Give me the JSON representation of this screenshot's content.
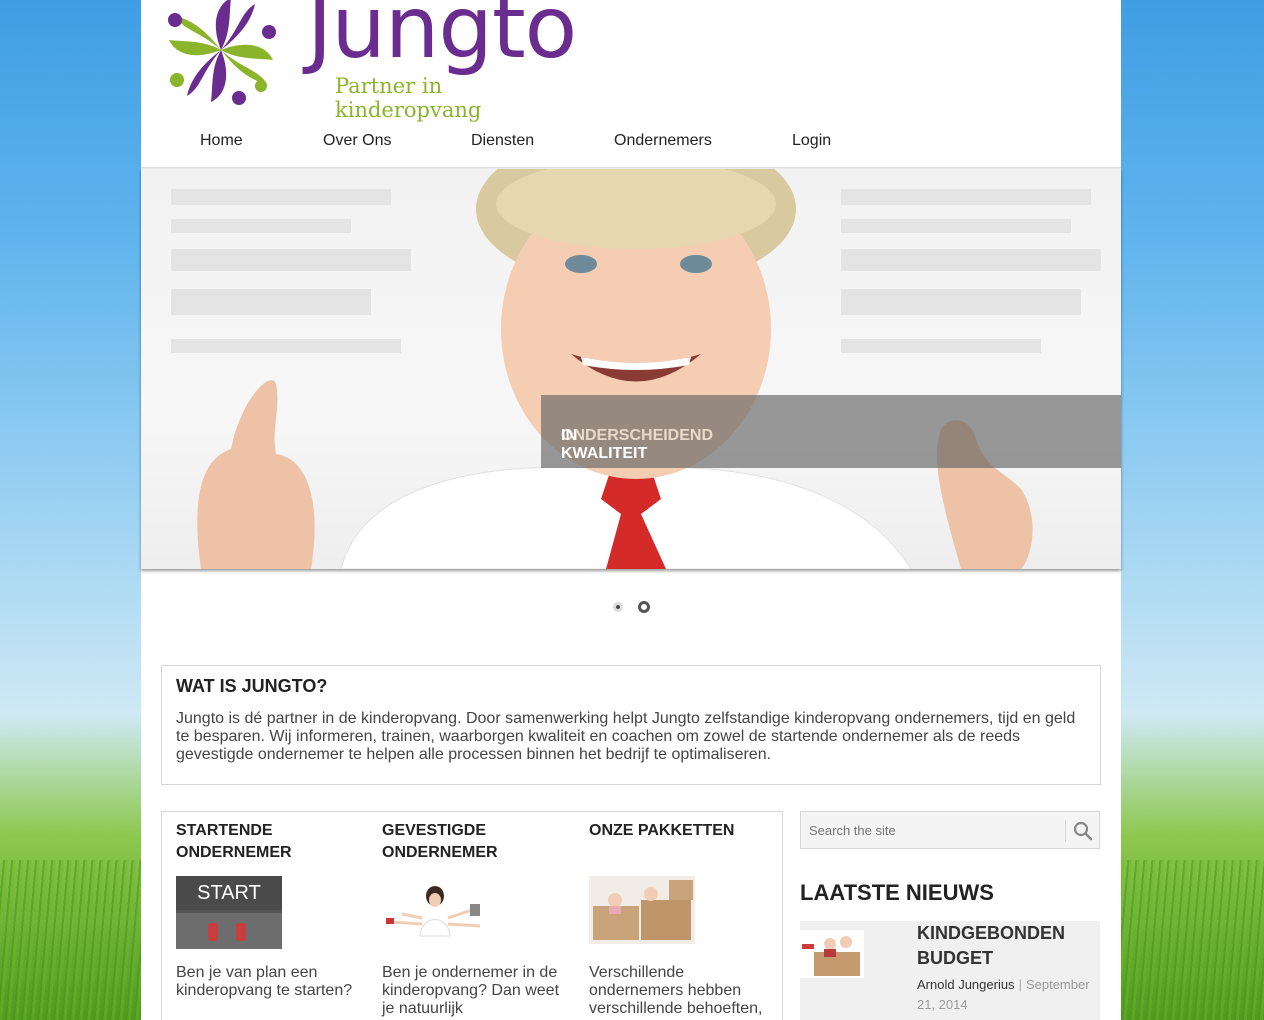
{
  "brand": {
    "name": "Jungto",
    "tagline": "Partner in kinderopvang",
    "purple": "#6b2c8f",
    "green": "#8ab52b"
  },
  "nav": {
    "items": [
      {
        "label": "Home"
      },
      {
        "label": "Over Ons"
      },
      {
        "label": "Diensten"
      },
      {
        "label": "Ondernemers"
      },
      {
        "label": "Login"
      }
    ]
  },
  "slider": {
    "caption_part1": "ONDERSCHEIDEND",
    "caption_part2": " IN KWALITEIT",
    "active_slide": 1,
    "slide_count": 2
  },
  "about": {
    "title": "WAT IS JUNGTO?",
    "text": "Jungto is dé partner in de kinderopvang. Door samenwerking helpt Jungto zelfstandige kinderopvang ondernemers, tijd en geld te besparen. Wij informeren, trainen, waarborgen kwaliteit en coachen om zowel de startende ondernemer als de reeds gevestigde ondernemer te helpen alle processen binnen het bedrijf te optimaliseren."
  },
  "services": [
    {
      "title": "STARTENDE ONDERNEMER",
      "image_text": "START",
      "text": "Ben je van plan een kinderopvang te starten?"
    },
    {
      "title": "GEVESTIGDE ONDERNEMER",
      "text": "Ben je ondernemer in de kinderopvang? Dan weet je natuurlijk"
    },
    {
      "title": "ONZE PAKKETTEN",
      "text": "Verschillende ondernemers hebben verschillende behoeften,"
    }
  ],
  "sidebar": {
    "search_placeholder": "Search the site",
    "news_heading": "LAATSTE NIEUWS",
    "news": [
      {
        "title": "KINDGEBONDEN BUDGET",
        "author": "Arnold Jungerius",
        "separator": "|",
        "date": "September 21, 2014"
      }
    ]
  },
  "icons": [
    "jungto-logo-icon",
    "search-icon"
  ]
}
